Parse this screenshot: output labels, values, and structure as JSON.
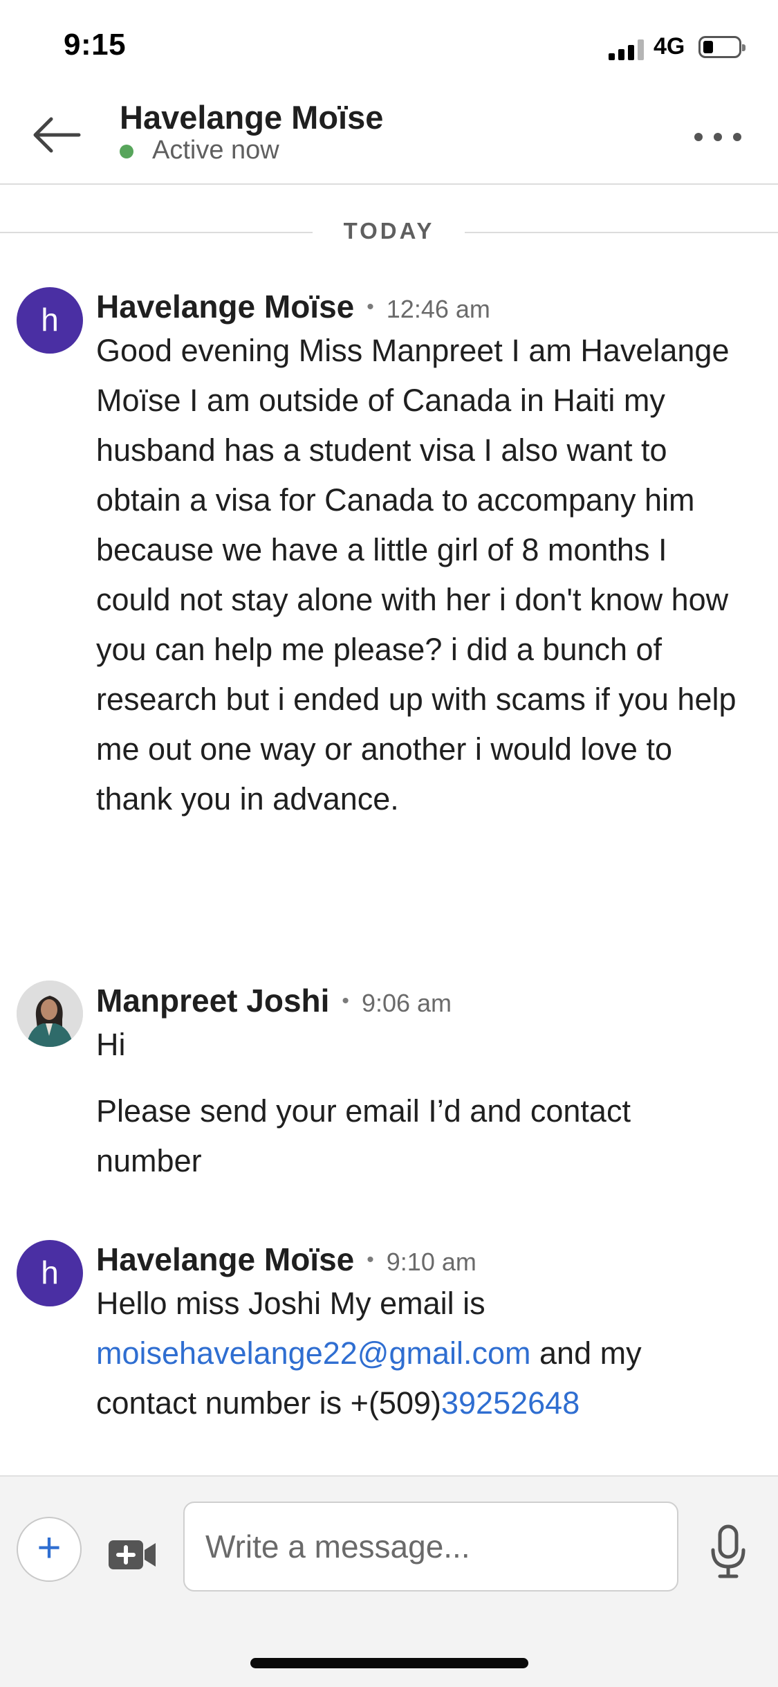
{
  "status_bar": {
    "time": "9:15",
    "network": "4G",
    "icons": [
      "signal-icon",
      "battery-icon"
    ]
  },
  "header": {
    "contact_name": "Havelange Moïse",
    "status": "Active now",
    "icons": {
      "back": "back-arrow-icon",
      "more": "more-icon"
    },
    "colors": {
      "active": "#57a55b"
    }
  },
  "divider": {
    "label": "TODAY"
  },
  "messages": [
    {
      "sender": "Havelange Moïse",
      "avatar_initial": "h",
      "time": "12:46 am",
      "text": "Good evening Miss Manpreet I am Havelange Moïse I am outside of Canada in Haiti my husband has a student visa I also want to obtain a visa for Canada to accompany him because we have a little girl of 8 months I could not stay alone with her i don't know how you can help me please? i did a bunch of research but i ended up with scams if you help me out one way or another i would love to thank you in advance."
    },
    {
      "sender": "Manpreet Joshi",
      "time": "9:06 am",
      "text1": "Hi",
      "text2": "Please send your email I’d and contact number"
    },
    {
      "sender": "Havelange Moïse",
      "avatar_initial": "h",
      "time": "9:10 am",
      "text_a": "Hello miss Joshi My email is ",
      "email": "moisehavelange22@gmail.com",
      "text_b": " and my contact number is +(509)",
      "phone": "39252648"
    }
  ],
  "composer": {
    "placeholder": "Write a message...",
    "add_symbol": "+",
    "icons": {
      "add": "plus-icon",
      "video": "video-camera-icon",
      "mic": "microphone-icon"
    }
  },
  "colors": {
    "avatar": "#4a2fa3",
    "link": "#2f6ed1",
    "text": "#1f1f1f"
  }
}
